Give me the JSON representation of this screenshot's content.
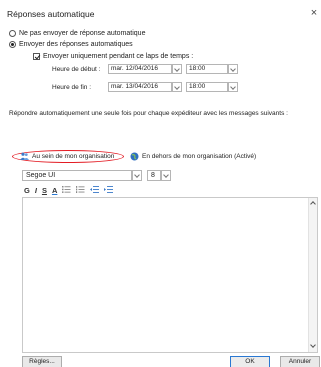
{
  "window": {
    "title": "Réponses automatique",
    "close_glyph": "×"
  },
  "options": {
    "no_reply": "Ne pas envoyer de réponse automatique",
    "send_reply": "Envoyer des réponses automatiques",
    "only_period": "Envoyer uniquement pendant ce laps de temps :"
  },
  "schedule": {
    "start_label": "Heure de début :",
    "start_date": "mar. 12/04/2016",
    "start_time": "18:00",
    "end_label": "Heure de fin :",
    "end_date": "mar. 13/04/2016",
    "end_time": "18:00"
  },
  "description": "Répondre automatiquement une seule fois pour chaque expéditeur avec les messages suivants :",
  "tabs": {
    "inside": "Au sein de mon organisation",
    "outside": "En dehors de mon organisation (Activé)"
  },
  "toolbar": {
    "font": "Segoe UI",
    "size": "8",
    "bold": "G",
    "italic": "I",
    "underline": "S",
    "font_color": "A"
  },
  "buttons": {
    "rules": "Règles...",
    "ok": "OK",
    "cancel": "Annuler"
  },
  "colors": {
    "accent": "#2a78d2",
    "highlight_oval": "#e31c24"
  }
}
